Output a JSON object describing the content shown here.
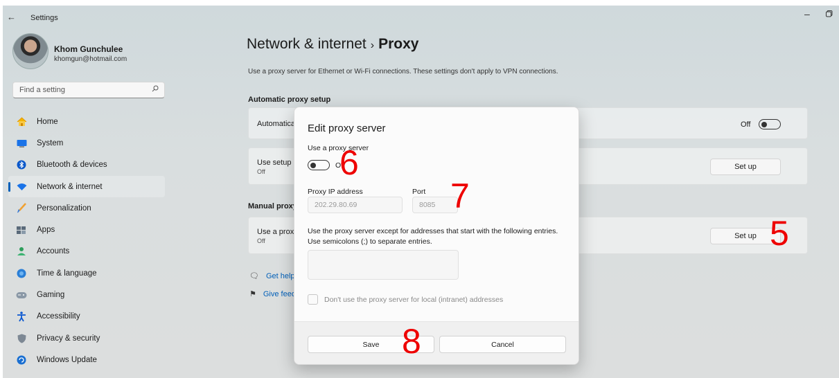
{
  "window": {
    "title": "Settings",
    "back_icon": "←",
    "minimize_icon": "–",
    "restore_icon": "▢"
  },
  "profile": {
    "name": "Khom Gunchulee",
    "email": "khomgun@hotmail.com"
  },
  "search": {
    "placeholder": "Find a setting"
  },
  "sidebar": {
    "items": [
      {
        "label": "Home",
        "icon": "home-icon",
        "active": false
      },
      {
        "label": "System",
        "icon": "system-icon",
        "active": false
      },
      {
        "label": "Bluetooth & devices",
        "icon": "bluetooth-icon",
        "active": false
      },
      {
        "label": "Network & internet",
        "icon": "wifi-icon",
        "active": true
      },
      {
        "label": "Personalization",
        "icon": "brush-icon",
        "active": false
      },
      {
        "label": "Apps",
        "icon": "apps-icon",
        "active": false
      },
      {
        "label": "Accounts",
        "icon": "account-icon",
        "active": false
      },
      {
        "label": "Time & language",
        "icon": "globe-icon",
        "active": false
      },
      {
        "label": "Gaming",
        "icon": "gamepad-icon",
        "active": false
      },
      {
        "label": "Accessibility",
        "icon": "accessibility-icon",
        "active": false
      },
      {
        "label": "Privacy & security",
        "icon": "shield-icon",
        "active": false
      },
      {
        "label": "Windows Update",
        "icon": "update-icon",
        "active": false
      }
    ]
  },
  "main": {
    "breadcrumb_parent": "Network & internet",
    "breadcrumb_sep": "›",
    "breadcrumb_current": "Proxy",
    "description": "Use a proxy server for Ethernet or Wi-Fi connections. These settings don't apply to VPN connections.",
    "auto_section": "Automatic proxy setup",
    "auto_detect_label": "Automatica",
    "auto_detect_state": "Off",
    "setup_script_label": "Use setup s",
    "setup_script_sub": "Off",
    "setup_button": "Set up",
    "manual_section": "Manual proxy",
    "manual_label": "Use a proxy",
    "manual_sub": "Off",
    "manual_setup_button": "Set up",
    "get_help": "Get help",
    "give_feedback": "Give feed"
  },
  "dialog": {
    "title": "Edit proxy server",
    "use_proxy_label": "Use a proxy server",
    "toggle_state": "Off",
    "ip_label": "Proxy IP address",
    "ip_value": "202.29.80.69",
    "port_label": "Port",
    "port_value": "8085",
    "exceptions_text_1": "Use the proxy server except for addresses that start with the following entries.",
    "exceptions_text_2": "Use semicolons (;) to separate entries.",
    "exceptions_value": "",
    "local_checkbox_label": "Don't use the proxy server for local (intranet) addresses",
    "local_checkbox_checked": false,
    "save": "Save",
    "cancel": "Cancel"
  },
  "annotations": {
    "n5": "5",
    "n6": "6",
    "n7": "7",
    "n8": "8"
  },
  "colors": {
    "accent": "#005fb8",
    "annotation": "#e00000"
  }
}
